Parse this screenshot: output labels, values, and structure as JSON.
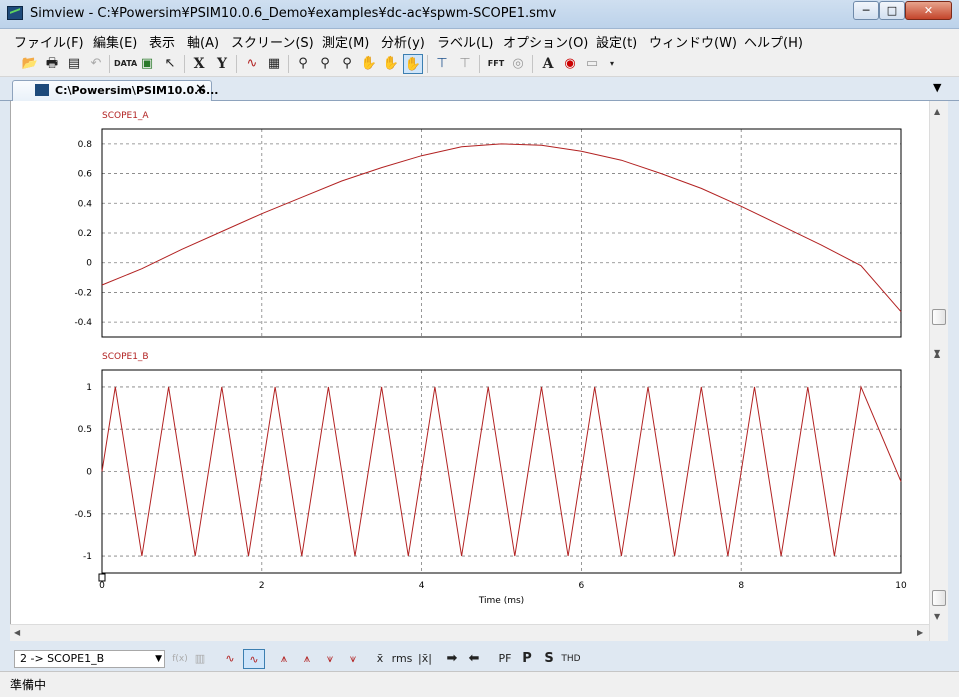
{
  "window": {
    "title": "Simview - C:¥Powersim¥PSIM10.0.6_Demo¥examples¥dc-ac¥spwm-SCOPE1.smv",
    "minimize": "─",
    "maximize": "□",
    "close": "✕"
  },
  "menu": [
    "ファイル(F)",
    "編集(E)",
    "表示",
    "軸(A)",
    "スクリーン(S)",
    "測定(M)",
    "分析(y)",
    "ラベル(L)",
    "オプション(O)",
    "設定(t)",
    "ウィンドウ(W)",
    "ヘルプ(H)"
  ],
  "toolbar": {
    "x_label": "X",
    "y_label": "Y",
    "data_label": "DATA",
    "fft_label": "FFT",
    "text_label": "A"
  },
  "tab": {
    "label": "C:\\Powersim\\PSIM10.0.6...",
    "close": "✕"
  },
  "bottom": {
    "selected_curve": "2 -> SCOPE1_B",
    "fx": "f(x)",
    "mean": "x̄",
    "rms": "rms",
    "abs_mean": "|x̄|",
    "pf": "PF",
    "p": "P",
    "s": "S",
    "thd": "THD"
  },
  "status": "準備中",
  "colors": {
    "trace": "#b22222",
    "label": "#b22222",
    "grid": "#7f7f7f"
  },
  "chart_data": [
    {
      "type": "line",
      "title": "SCOPE1_A",
      "xlabel": "",
      "ylabel": "",
      "xlim": [
        0,
        10
      ],
      "ylim": [
        -0.5,
        0.9
      ],
      "yticks": [
        0.8,
        0.6,
        0.4,
        0.2,
        0,
        -0.2,
        -0.4
      ],
      "xticks": [
        0,
        2,
        4,
        6,
        8,
        10
      ],
      "grid": true,
      "series": [
        {
          "x": [
            0,
            0.5,
            1,
            1.5,
            2,
            2.5,
            3,
            3.5,
            4,
            4.5,
            5,
            5.5,
            6,
            6.5,
            7,
            7.5,
            8,
            8.5,
            9,
            9.5,
            10
          ],
          "values": [
            -0.15,
            -0.04,
            0.09,
            0.21,
            0.33,
            0.44,
            0.55,
            0.64,
            0.72,
            0.78,
            0.8,
            0.79,
            0.75,
            0.69,
            0.6,
            0.5,
            0.38,
            0.25,
            0.12,
            -0.02,
            -0.33
          ]
        }
      ]
    },
    {
      "type": "line",
      "title": "SCOPE1_B",
      "xlabel": "Time (ms)",
      "ylabel": "",
      "xlim": [
        0,
        10
      ],
      "ylim": [
        -1.2,
        1.2
      ],
      "yticks": [
        1,
        0.5,
        0,
        -0.5,
        -1
      ],
      "xticks": [
        0,
        2,
        4,
        6,
        8,
        10
      ],
      "xtick_labels": [
        "0",
        "2",
        "4",
        "6",
        "8",
        "10"
      ],
      "grid": true,
      "series": [
        {
          "x": [
            0,
            0.167,
            0.5,
            0.833,
            1.167,
            1.5,
            1.833,
            2.167,
            2.5,
            2.833,
            3.167,
            3.5,
            3.833,
            4.167,
            4.5,
            4.833,
            5.167,
            5.5,
            5.833,
            6.167,
            6.5,
            6.833,
            7.167,
            7.5,
            7.833,
            8.167,
            8.5,
            8.833,
            9.167,
            9.5,
            10
          ],
          "values": [
            0,
            1,
            -1,
            1,
            -1,
            1,
            -1,
            1,
            -1,
            1,
            -1,
            1,
            -1,
            1,
            -1,
            1,
            -1,
            1,
            -1,
            1,
            -1,
            1,
            -1,
            1,
            -1,
            1,
            -1,
            1,
            -1,
            1,
            -0.12
          ]
        }
      ]
    }
  ]
}
